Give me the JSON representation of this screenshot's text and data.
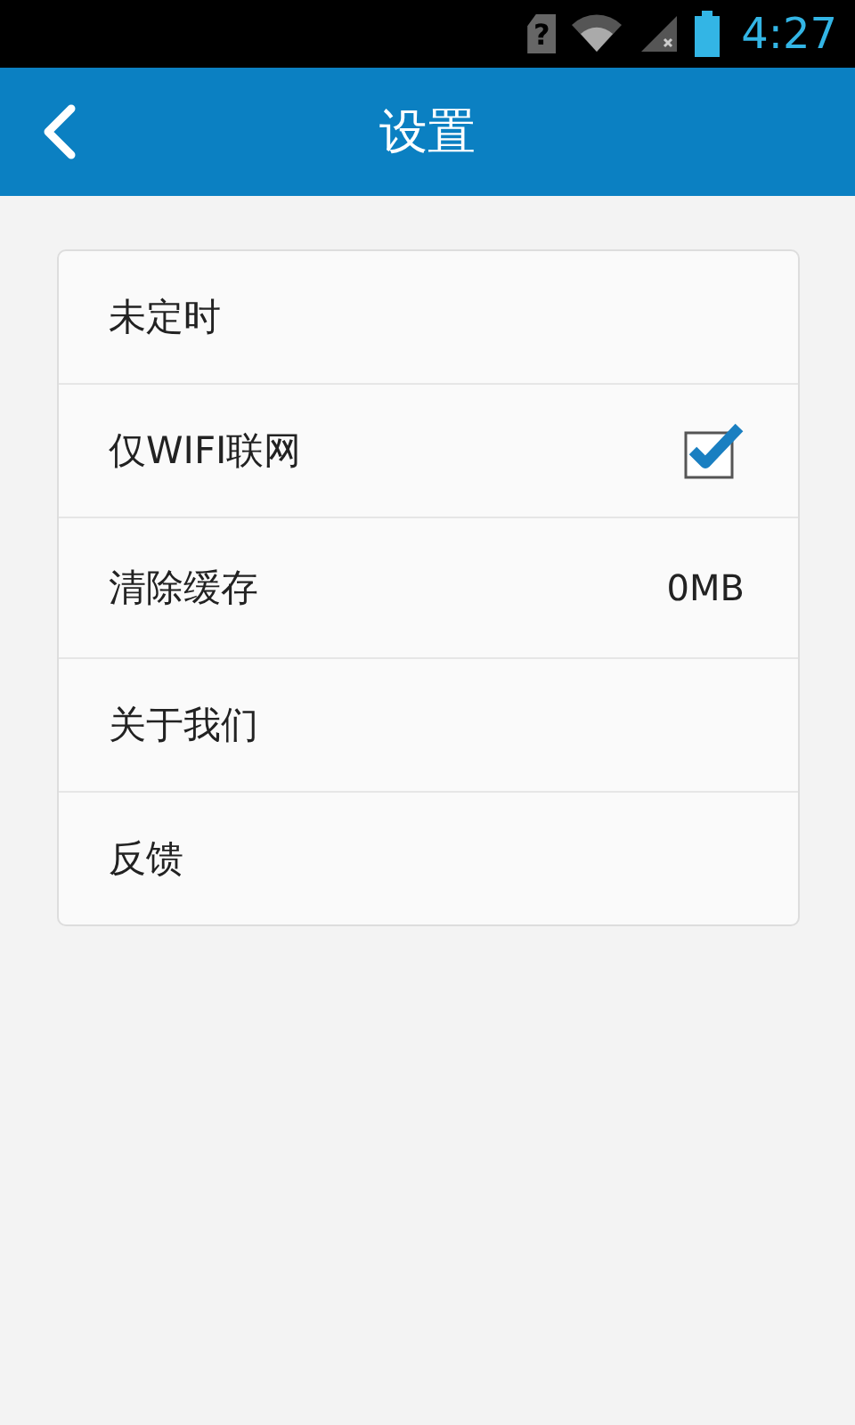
{
  "status_bar": {
    "sim_glyph": "?",
    "time": "4:27"
  },
  "header": {
    "title": "设置"
  },
  "settings": [
    {
      "kind": "plain",
      "label": "未定时"
    },
    {
      "kind": "checkbox",
      "label": "仅WIFI联网",
      "checked": true
    },
    {
      "kind": "value",
      "label": "清除缓存",
      "value": "0MB"
    },
    {
      "kind": "plain",
      "label": "关于我们"
    },
    {
      "kind": "plain",
      "label": "反馈"
    }
  ]
}
